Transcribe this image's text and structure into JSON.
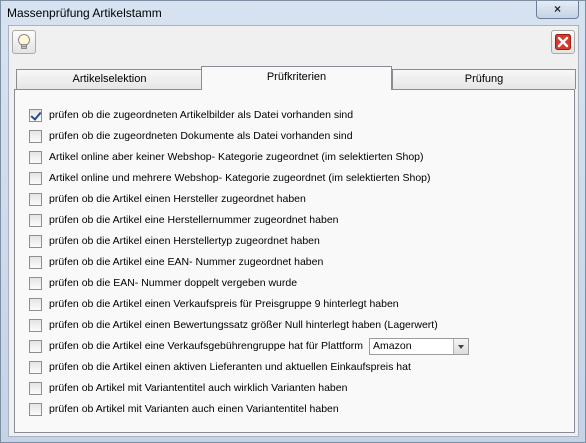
{
  "window": {
    "title": "Massenprüfung Artikelstamm"
  },
  "tabs": [
    {
      "label": "Artikelselektion",
      "active": false
    },
    {
      "label": "Prüfkriterien",
      "active": true
    },
    {
      "label": "Prüfung",
      "active": false
    }
  ],
  "icons": {
    "hint": "lightbulb-icon",
    "close": "close-x-icon",
    "window_close": "×"
  },
  "colors": {
    "close_icon": "#d73a2c"
  },
  "criteria": [
    {
      "label": "prüfen ob die zugeordneten Artikelbilder als Datei vorhanden sind",
      "checked": true
    },
    {
      "label": "prüfen ob die zugeordneten Dokumente als Datei vorhanden sind",
      "checked": false
    },
    {
      "label": "Artikel online aber keiner Webshop- Kategorie zugeordnet (im selektierten Shop)",
      "checked": false
    },
    {
      "label": "Artikel online und mehrere Webshop- Kategorie zugeordnet (im selektierten Shop)",
      "checked": false
    },
    {
      "label": "prüfen ob die Artikel einen Hersteller zugeordnet haben",
      "checked": false
    },
    {
      "label": "prüfen ob die Artikel eine Herstellernummer zugeordnet haben",
      "checked": false
    },
    {
      "label": "prüfen ob die Artikel einen Herstellertyp zugeordnet haben",
      "checked": false
    },
    {
      "label": "prüfen ob die Artikel eine EAN- Nummer zugeordnet haben",
      "checked": false
    },
    {
      "label": "prüfen ob die EAN- Nummer doppelt vergeben wurde",
      "checked": false
    },
    {
      "label": "prüfen ob die Artikel einen Verkaufspreis für Preisgruppe 9 hinterlegt haben",
      "checked": false
    },
    {
      "label": "prüfen ob die Artikel einen Bewertungssatz größer Null hinterlegt haben (Lagerwert)",
      "checked": false
    },
    {
      "label": "prüfen ob die Artikel eine Verkaufsgebührengruppe hat für Plattform",
      "checked": false,
      "select": "Amazon"
    },
    {
      "label": "prüfen ob die Artikel einen aktiven Lieferanten und aktuellen Einkaufspreis hat",
      "checked": false
    },
    {
      "label": "prüfen ob Artikel mit Variantentitel auch wirklich Varianten haben",
      "checked": false
    },
    {
      "label": "prüfen ob Artikel mit Varianten auch einen Variantentitel haben",
      "checked": false
    }
  ]
}
